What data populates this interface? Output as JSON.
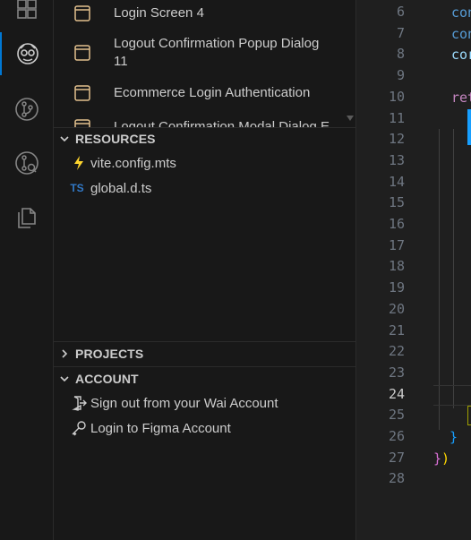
{
  "activity_bar": {
    "icons": [
      "extensions-icon",
      "wai-avatar-icon",
      "source-control-icon",
      "pull-request-icon",
      "explorer-icon"
    ]
  },
  "sidebar": {
    "screens": [
      {
        "label": "Login Screen 4"
      },
      {
        "label": "Logout Confirmation Popup Dialog 11"
      },
      {
        "label": "Ecommerce Login Authentication"
      },
      {
        "label": "Logout Confirmation Modal Dialog E"
      }
    ],
    "resources": {
      "title": "RESOURCES",
      "files": [
        {
          "name": "vite.config.mts",
          "icon": "vite-icon"
        },
        {
          "name": "global.d.ts",
          "icon_text": "TS"
        }
      ]
    },
    "projects": {
      "title": "PROJECTS"
    },
    "account": {
      "title": "ACCOUNT",
      "items": [
        {
          "label": "Sign out from your Wai Account"
        },
        {
          "label": "Login to Figma Account"
        }
      ]
    }
  },
  "editor": {
    "line_numbers": [
      "6",
      "7",
      "8",
      "9",
      "10",
      "11",
      "12",
      "13",
      "14",
      "15",
      "16",
      "17",
      "18",
      "19",
      "20",
      "21",
      "22",
      "23",
      "24",
      "25",
      "26",
      "27",
      "28"
    ],
    "current_line": "24",
    "snippets": {
      "l6": "con",
      "l7": "con",
      "l8": "cor",
      "l10": "ret",
      "l26": "}",
      "l27a": "}",
      "l27b": ")"
    }
  },
  "colors": {
    "accent": "#0078d4",
    "doc_icon": "#e2c08d",
    "ts_blue": "#3178c6",
    "vite_yellow": "#ffd62e",
    "keyword": "#569cd6",
    "brace_gold": "#ffd700",
    "brace_purple": "#da70d6",
    "brace_blue": "#179fff"
  }
}
